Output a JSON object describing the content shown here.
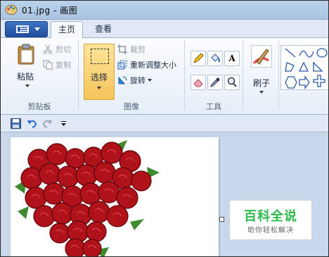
{
  "window": {
    "title": "01.jpg - 画图"
  },
  "tabs": {
    "home": "主页",
    "view": "查看"
  },
  "clipboard": {
    "paste": "粘贴",
    "cut": "剪切",
    "copy": "复制",
    "group": "剪贴板"
  },
  "image": {
    "select": "选择",
    "crop": "裁剪",
    "resize": "重新调整大小",
    "rotate": "旋转",
    "group": "图像"
  },
  "tools": {
    "text_tool": "A",
    "group": "工具"
  },
  "brushes": {
    "label": "刷子"
  },
  "canvas": {
    "subject": "heart-shaped red rose bouquet"
  },
  "watermark": {
    "title": "百科全说",
    "subtitle": "助你轻松解决"
  },
  "colors": {
    "accent": "#2fb84a",
    "ribbon": "#e6eef8",
    "workspace": "#c9d7ea",
    "select_active": "#f6c45a"
  }
}
